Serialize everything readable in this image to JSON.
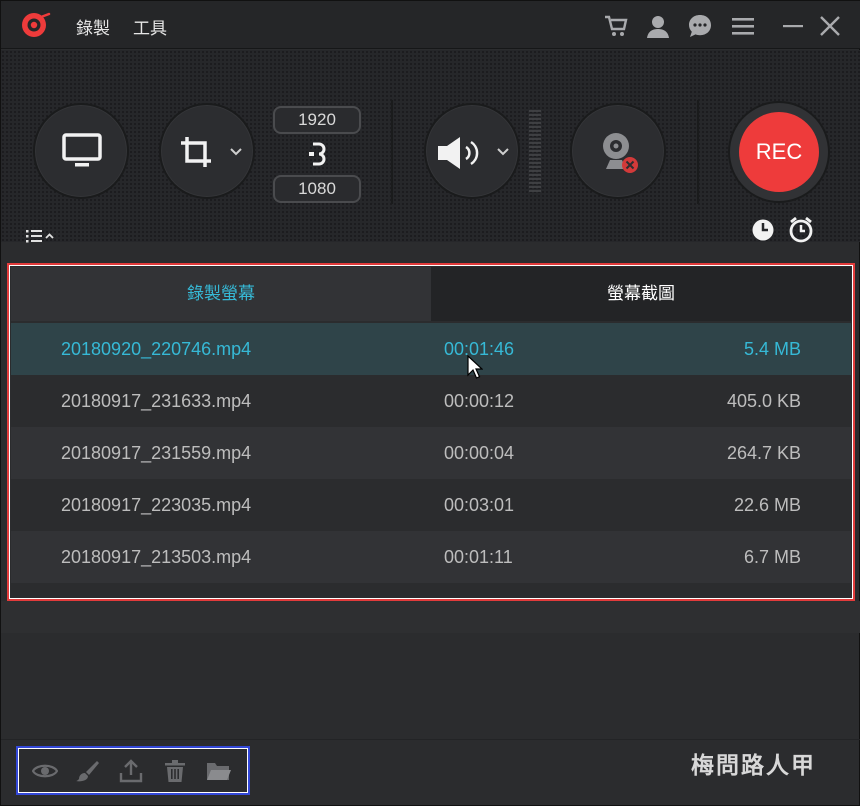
{
  "menu": {
    "record": "錄製",
    "tools": "工具"
  },
  "titlebar_icons": [
    "cart-icon",
    "user-icon",
    "chat-icon",
    "hamburger-menu-icon",
    "minimize-icon",
    "close-icon"
  ],
  "resolution": {
    "width": "1920",
    "height": "1080"
  },
  "rec_button": "REC",
  "tabs": {
    "recordings": "錄製螢幕",
    "screenshots": "螢幕截圖"
  },
  "files": [
    {
      "name": "20180920_220746.mp4",
      "duration": "00:01:46",
      "size": "5.4 MB",
      "selected": true
    },
    {
      "name": "20180917_231633.mp4",
      "duration": "00:00:12",
      "size": "405.0 KB",
      "selected": false
    },
    {
      "name": "20180917_231559.mp4",
      "duration": "00:00:04",
      "size": "264.7 KB",
      "selected": false
    },
    {
      "name": "20180917_223035.mp4",
      "duration": "00:03:01",
      "size": "22.6 MB",
      "selected": false
    },
    {
      "name": "20180917_213503.mp4",
      "duration": "00:01:11",
      "size": "6.7 MB",
      "selected": false
    }
  ],
  "bottom_tools": [
    "eye-icon",
    "brush-icon",
    "upload-icon",
    "trash-icon",
    "folder-icon"
  ],
  "watermark": "梅問路人甲",
  "colors": {
    "accent": "#36b9d6",
    "rec": "#ee3b3b",
    "selected_row": "#2f4449"
  }
}
